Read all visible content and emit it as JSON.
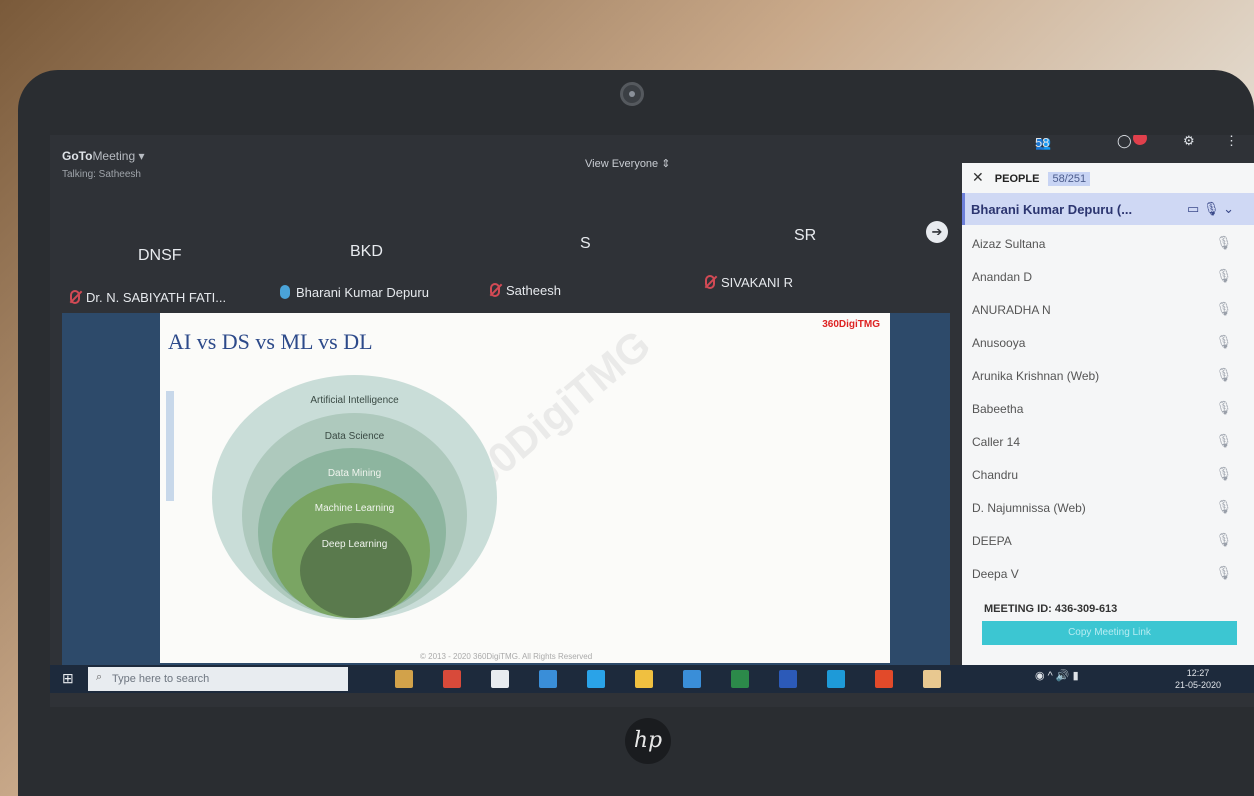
{
  "app": {
    "name_bold": "GoTo",
    "name_rest": "Meeting",
    "menu_chevron": "▾",
    "talking": "Talking: Satheesh",
    "view_mode": "View Everyone"
  },
  "top_icons": {
    "people_count": "58",
    "people_icon": "people-icon",
    "chat_icon": "chat-icon",
    "settings_icon": "gear-icon",
    "more_icon": "more-icon"
  },
  "participants": [
    {
      "initials": "DNSF",
      "name": "Dr. N. SABIYATH FATI...",
      "mic": "muted"
    },
    {
      "initials": "BKD",
      "name": "Bharani Kumar Depuru",
      "mic": "active"
    },
    {
      "initials": "S",
      "name": "Satheesh",
      "mic": "muted"
    },
    {
      "initials": "SR",
      "name": "SIVAKANI R",
      "mic": "muted"
    }
  ],
  "slide": {
    "title": "AI vs DS vs ML vs DL",
    "logo_text": "360DigiTMG",
    "watermark": "360DigiTMG",
    "footer": "© 2013 - 2020 360DigiTMG. All Rights Reserved",
    "circles": [
      "Artificial Intelligence",
      "Data Science",
      "Data Mining",
      "Machine Learning",
      "Deep Learning"
    ]
  },
  "people_panel": {
    "title": "PEOPLE",
    "count": "58/251",
    "organizer": "Bharani Kumar Depuru (...",
    "attendees": [
      "Aizaz Sultana",
      "Anandan D",
      "ANURADHA N",
      "Anusooya",
      "Arunika Krishnan (Web)",
      "Babeetha",
      "Caller 14",
      "Chandru",
      "D. Najumnissa (Web)",
      "DEEPA",
      "Deepa V"
    ],
    "meeting_id_label": "MEETING ID:",
    "meeting_id": "436-309-613",
    "copy_link": "Copy Meeting Link"
  },
  "taskbar": {
    "search_placeholder": "Type here to search",
    "time": "12:27",
    "date": "21-05-2020",
    "app_colors": [
      "#d2a24a",
      "#d84a3a",
      "#e8ecf0",
      "#3a8ed8",
      "#2aa3e8",
      "#f0c040",
      "#3a8ed8",
      "#2c8a4a",
      "#2c5ab8",
      "#1e9ad8",
      "#e24a2a",
      "#e8c890"
    ]
  },
  "device": {
    "brand": "hp"
  }
}
